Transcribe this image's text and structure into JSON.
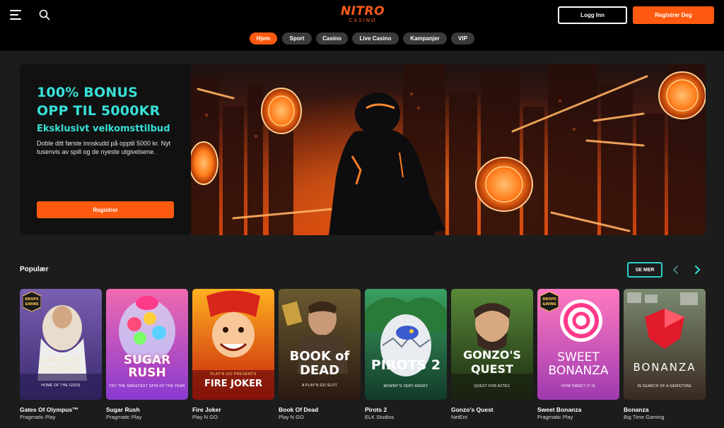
{
  "header": {
    "logo_main": "NITRO",
    "logo_sub": "CASINO",
    "login_label": "Logg Inn",
    "register_label": "Registrer Deg"
  },
  "nav": [
    {
      "label": "Hjem",
      "active": true
    },
    {
      "label": "Sport",
      "active": false
    },
    {
      "label": "Casino",
      "active": false
    },
    {
      "label": "Live Casino",
      "active": false
    },
    {
      "label": "Kampanjer",
      "active": false
    },
    {
      "label": "VIP",
      "active": false
    }
  ],
  "hero": {
    "headline_1": "100% BONUS",
    "headline_2": "OPP TIL 5000KR",
    "subheadline": "Eksklusivt velkomsttilbud",
    "body": "Doble ditt første innskudd på opptil 5000 kr. Nyt tusenvis av spill og de nyeste utgivelsene.",
    "cta_label": "Registrer"
  },
  "popular": {
    "title": "Populær",
    "see_more_label": "SE MER",
    "games": [
      {
        "name": "Gates Of Olympus™",
        "provider": "Pragmatic Play",
        "thumb_title": "GATES OF OLYMPUS",
        "thumb_sub": "HOME OF THE GODS",
        "badge": "DROPS & WINS"
      },
      {
        "name": "Sugar Rush",
        "provider": "Pragmatic Play",
        "thumb_title": "SUGAR RUSH",
        "thumb_sub": "TRY THE SWEETEST SPIN OF THE YEAR",
        "badge": ""
      },
      {
        "name": "Fire Joker",
        "provider": "Play N GO",
        "thumb_title": "FIRE JOKER",
        "thumb_sub": "PLAY'N GO PRESENTS",
        "badge": ""
      },
      {
        "name": "Book Of Dead",
        "provider": "Play N GO",
        "thumb_title": "BOOK of DEAD",
        "thumb_sub": "A PLAY'N GO SLOT",
        "badge": ""
      },
      {
        "name": "Pirots 2",
        "provider": "ELK Studios",
        "thumb_title": "PIROTS 2",
        "thumb_sub": "MOMMY'S VERY ANGRY",
        "badge": ""
      },
      {
        "name": "Gonzo's Quest",
        "provider": "NetEnt",
        "thumb_title": "GONZO'S QUEST",
        "thumb_sub": "QUEST FOR AZTEC",
        "badge": ""
      },
      {
        "name": "Sweet Bonanza",
        "provider": "Pragmatic Play",
        "thumb_title": "SWEET BONANZA",
        "thumb_sub": "HOW SWEET IT IS",
        "badge": "DROPS & WINS"
      },
      {
        "name": "Bonanza",
        "provider": "Big Time Gaming",
        "thumb_title": "BONANZA",
        "thumb_sub": "IN SEARCH OF A GEMSTONE",
        "badge": ""
      }
    ]
  },
  "colors": {
    "accent": "#ff5a0f",
    "teal": "#37e0d8",
    "background": "#1c1c1c",
    "header": "#000000"
  }
}
